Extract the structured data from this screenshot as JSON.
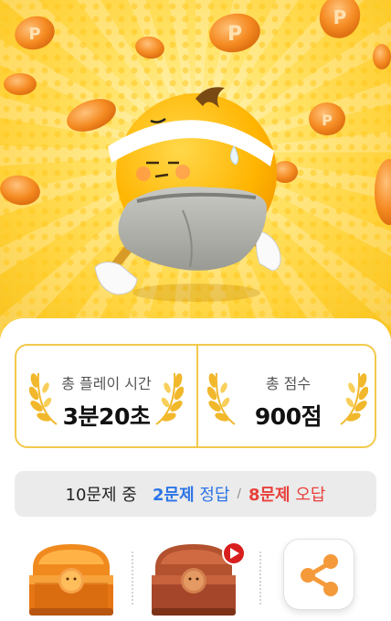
{
  "result": {
    "play_time_label": "총 플레이 시간",
    "play_time_value": "3분20초",
    "score_label": "총 점수",
    "score_value": "900점"
  },
  "summary": {
    "total_text": "10문제 중",
    "correct_count": "2문제",
    "correct_label": "정답",
    "separator": "/",
    "wrong_count": "8문제",
    "wrong_label": "오답"
  },
  "actions": {
    "chest_open": "treasure-chest-icon",
    "chest_ad": "treasure-chest-video-icon",
    "share": "share-icon"
  },
  "colors": {
    "accent_gold": "#f3c94c",
    "correct_blue": "#2c74e6",
    "wrong_red": "#e8413b",
    "share_orange": "#f59a3a"
  }
}
